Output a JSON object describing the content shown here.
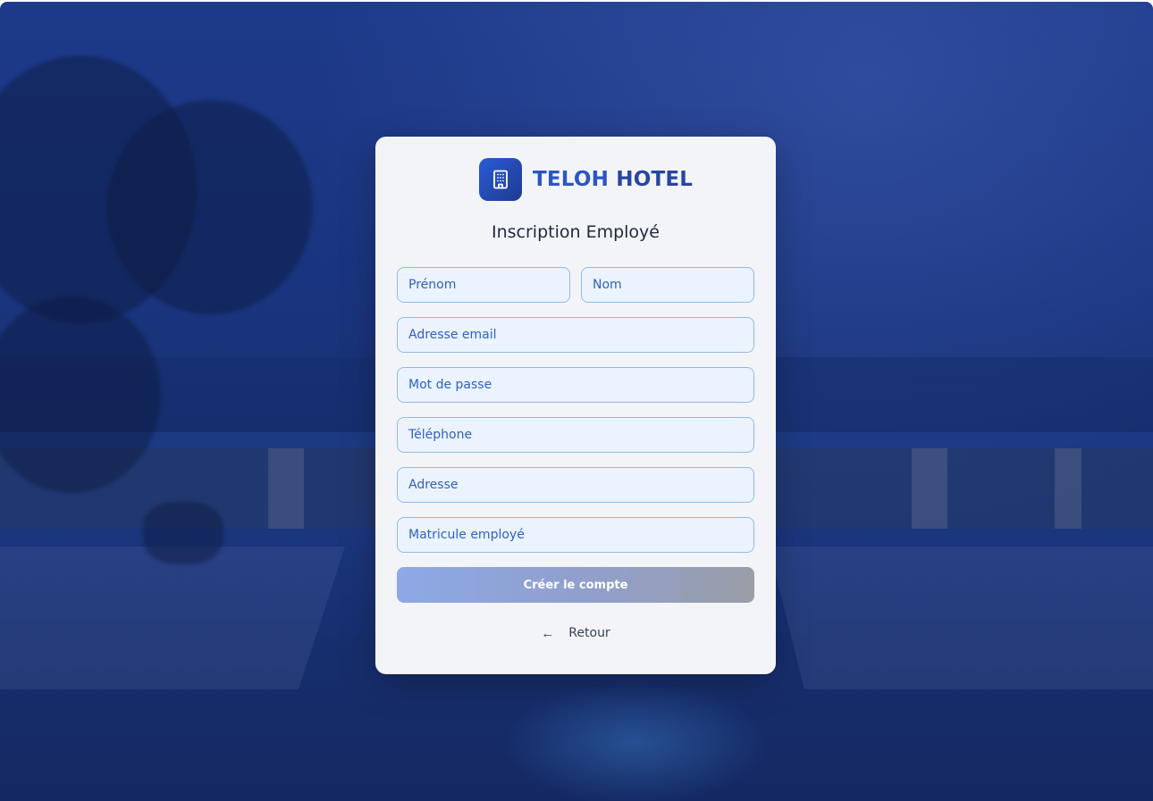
{
  "brand": {
    "name_part1": "TELOH",
    "name_part2": "HOTEL",
    "icon": "building-icon"
  },
  "form": {
    "title": "Inscription Employé",
    "fields": {
      "first_name": {
        "placeholder": "Prénom",
        "value": ""
      },
      "last_name": {
        "placeholder": "Nom",
        "value": ""
      },
      "email": {
        "placeholder": "Adresse email",
        "value": ""
      },
      "password": {
        "placeholder": "Mot de passe",
        "value": ""
      },
      "phone": {
        "placeholder": "Téléphone",
        "value": ""
      },
      "address": {
        "placeholder": "Adresse",
        "value": ""
      },
      "employee_id": {
        "placeholder": "Matricule employé",
        "value": ""
      }
    },
    "submit_label": "Créer le compte",
    "back_label": "Retour",
    "back_icon": "arrow-left-icon"
  },
  "colors": {
    "brand_blue": "#2a56c6",
    "field_border": "#8fbce8",
    "field_bg": "#eaf3fe",
    "card_bg": "#f3f4f8",
    "backdrop": "#1a357f"
  }
}
